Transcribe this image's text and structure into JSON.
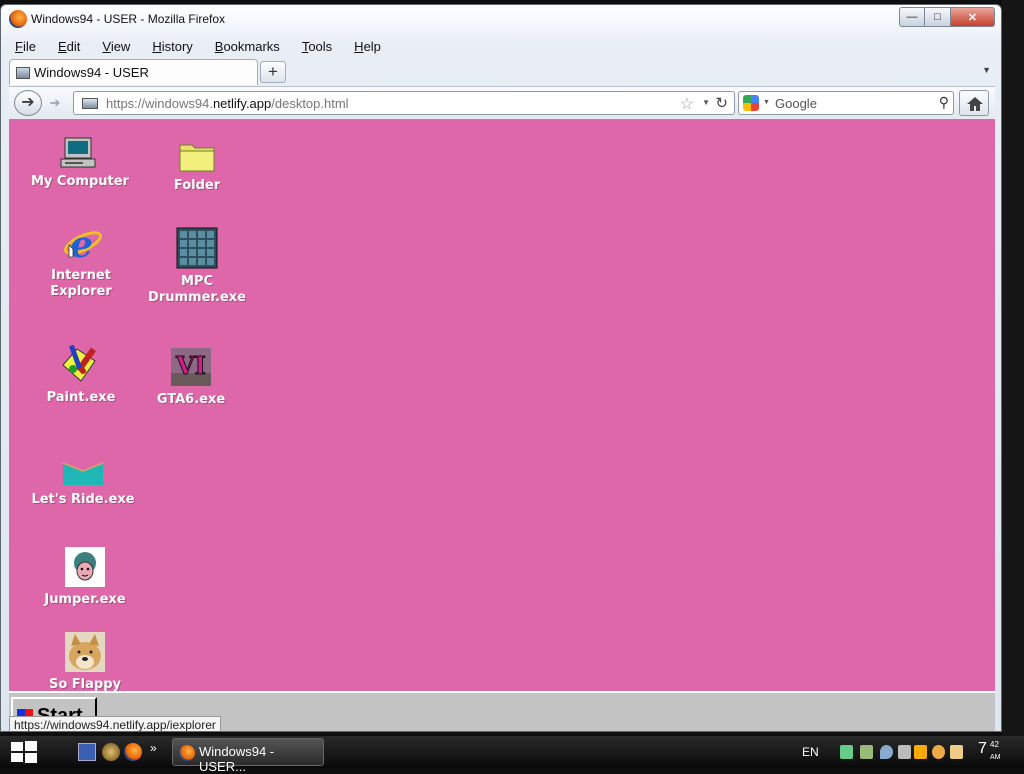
{
  "browser": {
    "window_title": "Windows94 - USER - Mozilla Firefox",
    "menu": [
      "File",
      "Edit",
      "View",
      "History",
      "Bookmarks",
      "Tools",
      "Help"
    ],
    "tab_title": "Windows94 - USER",
    "new_tab": "+",
    "url_prefix": "https://windows94.",
    "url_domain": "netlify.app",
    "url_path": "/desktop.html",
    "search_placeholder": "Google",
    "status_text": "https://windows94.netlify.app/iexplorer"
  },
  "desktop": {
    "background": "#dd67a8",
    "icons": [
      {
        "label": "My Computer",
        "icon": "computer-icon"
      },
      {
        "label": "Folder",
        "icon": "folder-icon"
      },
      {
        "label": "Internet Explorer",
        "icon": "ie-icon"
      },
      {
        "label": "MPC Drummer.exe",
        "icon": "drum-grid-icon"
      },
      {
        "label": "Paint.exe",
        "icon": "paint-icon"
      },
      {
        "label": "GTA6.exe",
        "icon": "gta-icon"
      },
      {
        "label": "Let's Ride.exe",
        "icon": "ride-icon"
      },
      {
        "label": "Jumper.exe",
        "icon": "jumper-icon"
      },
      {
        "label": "So Flappy",
        "icon": "doge-icon"
      }
    ],
    "start_label": "Start"
  },
  "os_taskbar": {
    "active_window": "Windows94 - USER...",
    "language": "EN",
    "clock_hour": "7",
    "clock_minutes": "42",
    "clock_ampm": "AM"
  }
}
